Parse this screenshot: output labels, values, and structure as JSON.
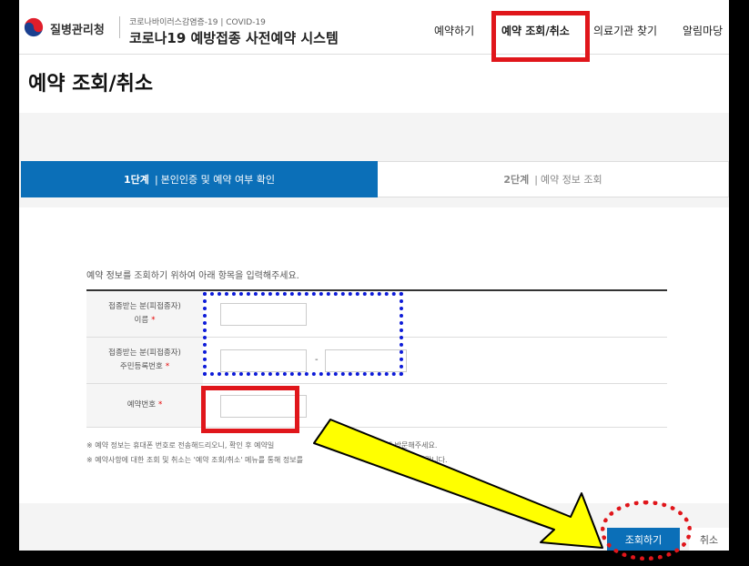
{
  "header": {
    "agency": "질병관리청",
    "system_subtitle": "코로나바이러스감염증-19 | COVID-19",
    "system_title": "코로나19 예방접종 사전예약 시스템",
    "nav": [
      {
        "label": "예약하기"
      },
      {
        "label": "예약 조회/취소"
      },
      {
        "label": "의료기관 찾기"
      },
      {
        "label": "알림마당"
      }
    ]
  },
  "page_title": "예약 조회/취소",
  "steps": [
    {
      "num": "1단계",
      "label": "본인인증 및 예약 여부 확인"
    },
    {
      "num": "2단계",
      "label": "예약 정보 조회"
    }
  ],
  "intro": "예약 정보를 조회하기 위하여 아래 항목을 입력해주세요.",
  "form": {
    "name_label_1": "접종받는 분(피접종자)",
    "name_label_2": "이름",
    "rrn_label_1": "접종받는 분(피접종자)",
    "rrn_label_2": "주민등록번호",
    "rrn_dash": "-",
    "reservation_label": "예약번호",
    "required_mark": "*"
  },
  "notes": [
    "※ 예약 정보는 휴대폰 번호로 전송해드리오니, 확인 후 예약일",
    "※ 예약사항에 대한 조회 및 취소는 '예약 조회/취소' 메뉴를 통해 정보를"
  ],
  "notes_tail": [
    "에 방문해주세요.",
    "바랍니다."
  ],
  "buttons": {
    "search": "조회하기",
    "cancel": "취소"
  },
  "colors": {
    "primary": "#0b6fb8",
    "annotation_red": "#e0161b",
    "annotation_blue": "#0d1bd8",
    "arrow_yellow": "#ffff00"
  }
}
